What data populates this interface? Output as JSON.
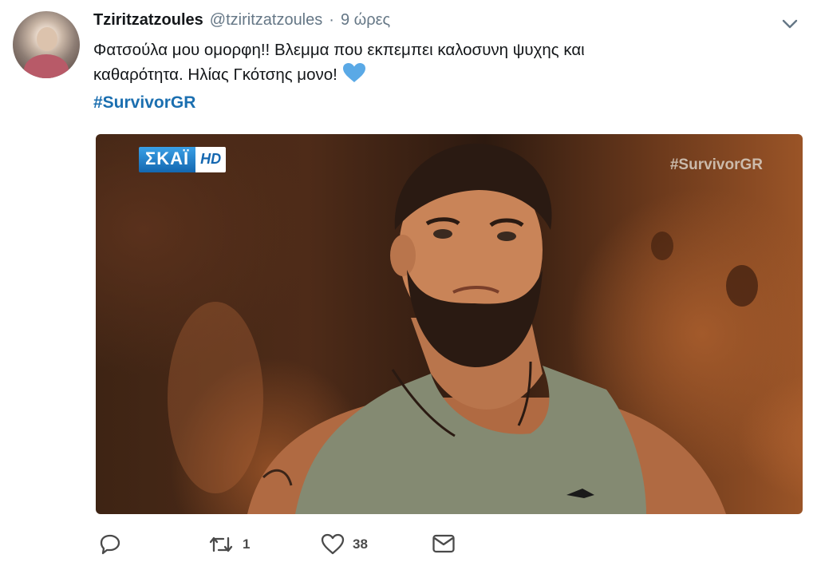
{
  "tweet": {
    "author_name": "Tziritzatzoules",
    "author_handle": "@tziritzatzoules",
    "separator": "·",
    "time": "9 ώρες",
    "text_line1": "Φατσούλα μου ομορφη!! Βλεμμα που εκπεμπει καλοσυνη ψυχης και",
    "text_line2": "καθαρότητα. Ηλίας Γκότσης μονο!",
    "emoji": "blue-heart-icon",
    "hashtag": "#SurvivorGR"
  },
  "media": {
    "channel_logo_text": "ΣΚΑΪ",
    "channel_logo_badge": "HD",
    "watermark": "#SurvivorGR"
  },
  "actions": {
    "reply_count": "",
    "retweet_count": "1",
    "like_count": "38",
    "icons": [
      "reply-icon",
      "retweet-icon",
      "like-icon",
      "message-icon"
    ]
  },
  "colors": {
    "hashtag": "#1b6fb0",
    "heart": "#5aa9e6",
    "muted": "#657786"
  }
}
